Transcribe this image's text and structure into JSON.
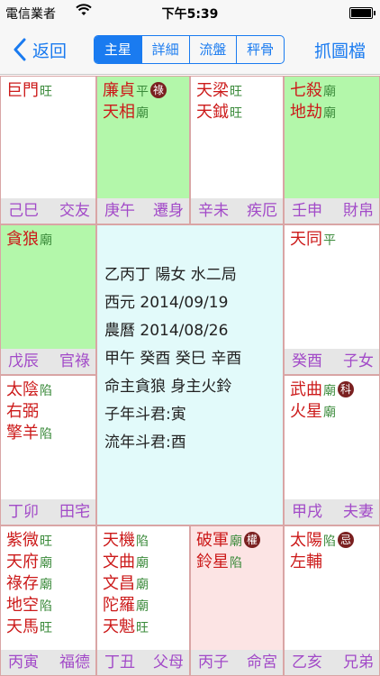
{
  "status_bar": {
    "carrier": "電信業者",
    "time": "下午5:39"
  },
  "nav": {
    "back_label": "返回",
    "segments": [
      {
        "label": "主星",
        "active": true
      },
      {
        "label": "詳細",
        "active": false
      },
      {
        "label": "流盤",
        "active": false
      },
      {
        "label": "秤骨",
        "active": false
      }
    ],
    "capture_label": "抓圖檔"
  },
  "palaces": [
    {
      "stars": [
        {
          "name": "巨門",
          "brightness": "旺"
        }
      ],
      "stem_branch": "己巳",
      "palace": "交友",
      "bg": "white"
    },
    {
      "stars": [
        {
          "name": "廉貞",
          "brightness": "平",
          "hua": "祿"
        },
        {
          "name": "天相",
          "brightness": "廟"
        }
      ],
      "stem_branch": "庚午",
      "palace": "遷身",
      "bg": "green"
    },
    {
      "stars": [
        {
          "name": "天梁",
          "brightness": "旺"
        },
        {
          "name": "天鉞",
          "brightness": "旺"
        }
      ],
      "stem_branch": "辛未",
      "palace": "疾厄",
      "bg": "white"
    },
    {
      "stars": [
        {
          "name": "七殺",
          "brightness": "廟"
        },
        {
          "name": "地劫",
          "brightness": "廟"
        }
      ],
      "stem_branch": "壬申",
      "palace": "財帛",
      "bg": "green"
    },
    {
      "stars": [
        {
          "name": "貪狼",
          "brightness": "廟"
        }
      ],
      "stem_branch": "戊辰",
      "palace": "官祿",
      "bg": "green"
    },
    {
      "stars": [
        {
          "name": "天同",
          "brightness": "平"
        }
      ],
      "stem_branch": "癸酉",
      "palace": "子女",
      "bg": "white"
    },
    {
      "stars": [
        {
          "name": "太陰",
          "brightness": "陷"
        },
        {
          "name": "右弼",
          "brightness": ""
        },
        {
          "name": "擎羊",
          "brightness": "陷"
        }
      ],
      "stem_branch": "丁卯",
      "palace": "田宅",
      "bg": "white"
    },
    {
      "stars": [
        {
          "name": "武曲",
          "brightness": "廟",
          "hua": "科"
        },
        {
          "name": "火星",
          "brightness": "廟"
        }
      ],
      "stem_branch": "甲戌",
      "palace": "夫妻",
      "bg": "white"
    },
    {
      "stars": [
        {
          "name": "紫微",
          "brightness": "旺"
        },
        {
          "name": "天府",
          "brightness": "廟"
        },
        {
          "name": "祿存",
          "brightness": "廟"
        },
        {
          "name": "地空",
          "brightness": "陷"
        },
        {
          "name": "天馬",
          "brightness": "旺"
        }
      ],
      "stem_branch": "丙寅",
      "palace": "福德",
      "bg": "white"
    },
    {
      "stars": [
        {
          "name": "天機",
          "brightness": "陷"
        },
        {
          "name": "文曲",
          "brightness": "廟"
        },
        {
          "name": "文昌",
          "brightness": "廟"
        },
        {
          "name": "陀羅",
          "brightness": "廟"
        },
        {
          "name": "天魁",
          "brightness": "旺"
        }
      ],
      "stem_branch": "丁丑",
      "palace": "父母",
      "bg": "white"
    },
    {
      "stars": [
        {
          "name": "破軍",
          "brightness": "廟",
          "hua": "權"
        },
        {
          "name": "鈴星",
          "brightness": "陷"
        }
      ],
      "stem_branch": "丙子",
      "palace": "命宮",
      "bg": "pink"
    },
    {
      "stars": [
        {
          "name": "太陽",
          "brightness": "陷",
          "hua": "忌"
        },
        {
          "name": "左輔",
          "brightness": ""
        }
      ],
      "stem_branch": "乙亥",
      "palace": "兄弟",
      "bg": "white"
    }
  ],
  "center": {
    "lines": [
      "乙丙丁 陽女 水二局",
      "西元 2014/09/19",
      "農曆 2014/08/26",
      "甲午 癸酉 癸巳 辛酉",
      "命主貪狼 身主火鈴",
      "子年斗君:寅",
      "流年斗君:酉"
    ]
  },
  "colors": {
    "accent": "#1a7bf0",
    "star_name": "#cc1a1a",
    "brightness": "#3a8a3a",
    "footer_text": "#a24ac8",
    "green_bg": "#b3f7aa",
    "pink_bg": "#fce4e4",
    "center_bg": "#e2fafa",
    "hua_badge": "#7a2020"
  },
  "icons": {
    "back": "chevron-left-icon",
    "wifi": "wifi-icon",
    "battery": "battery-icon"
  },
  "battery_level_fraction": 1.0
}
